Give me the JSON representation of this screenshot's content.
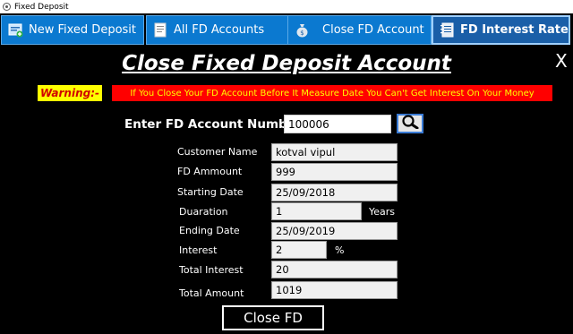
{
  "window": {
    "title": "Fixed Deposit"
  },
  "tabs": [
    {
      "label": "New Fixed Deposit",
      "icon": "new-deposit-icon"
    },
    {
      "label": "All FD Accounts",
      "icon": "document-icon"
    },
    {
      "label": "Close FD Account",
      "icon": "money-bag-icon"
    },
    {
      "label": "FD Interest Rate",
      "icon": "notebook-icon",
      "active": true
    }
  ],
  "page": {
    "title": "Close Fixed Deposit Account",
    "close_symbol": "X"
  },
  "warning": {
    "label": "Warning:-",
    "text": "If You Close Your FD Account Before It Measure Date You Can't Get Interest On Your Money"
  },
  "search": {
    "label": "Enter FD Account Number",
    "value": "100006",
    "icon": "search-icon"
  },
  "fields": {
    "customer_name": {
      "label": "Customer Name",
      "value": "kotval vipul"
    },
    "fd_amount": {
      "label": "FD  Ammount",
      "value": "999"
    },
    "starting_date": {
      "label": "Starting Date",
      "value": "25/09/2018"
    },
    "duration": {
      "label": "Duaration",
      "value": "1",
      "unit": "Years"
    },
    "ending_date": {
      "label": "Ending Date",
      "value": "25/09/2019"
    },
    "interest": {
      "label": "Interest",
      "value": "2",
      "unit": "%"
    },
    "total_interest": {
      "label": "Total Interest",
      "value": "20"
    },
    "total_amount": {
      "label": "Total Amount",
      "value": "1019"
    }
  },
  "actions": {
    "close_fd_label": "Close FD"
  },
  "colors": {
    "background": "#000000",
    "tab_blue": "#0b79d0",
    "warning_label_bg": "#ffff00",
    "warning_text_bg": "#ff0000"
  }
}
